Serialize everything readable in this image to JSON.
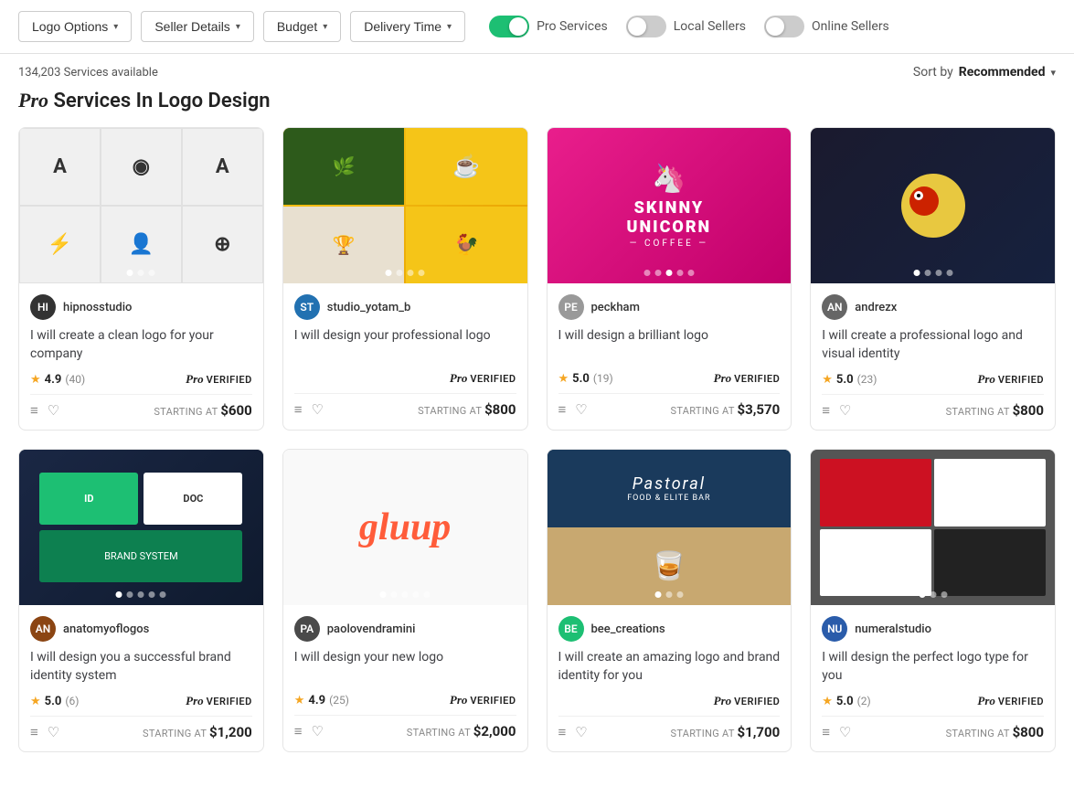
{
  "filterBar": {
    "buttons": [
      {
        "id": "logo-options",
        "label": "Logo Options"
      },
      {
        "id": "seller-details",
        "label": "Seller Details"
      },
      {
        "id": "budget",
        "label": "Budget"
      },
      {
        "id": "delivery-time",
        "label": "Delivery Time"
      }
    ],
    "toggles": [
      {
        "id": "pro-services",
        "label": "Pro Services",
        "state": "on"
      },
      {
        "id": "local-sellers",
        "label": "Local Sellers",
        "state": "off"
      },
      {
        "id": "online-sellers",
        "label": "Online Sellers",
        "state": "off"
      }
    ]
  },
  "resultsBar": {
    "count": "134,203 Services available",
    "sortLabel": "Sort by",
    "sortValue": "Recommended"
  },
  "pageTitle": {
    "prefix": "Pro",
    "suffix": " Services In Logo Design"
  },
  "cards": [
    {
      "id": "card-1",
      "bgClass": "bg-gray",
      "sellerName": "hipnosstudio",
      "sellerColor": "#222",
      "title": "I will create a clean logo for your company",
      "rating": "4.9",
      "ratingCount": "(40)",
      "price": "$600",
      "dots": 3,
      "activeDot": 0,
      "artType": "logo-grid"
    },
    {
      "id": "card-2",
      "bgClass": "bg-yellow",
      "sellerName": "studio_yotam_b",
      "sellerColor": "#2271b1",
      "title": "I will design your professional logo",
      "rating": null,
      "ratingCount": null,
      "price": "$800",
      "dots": 4,
      "activeDot": 0,
      "artType": "yellow-collage"
    },
    {
      "id": "card-3",
      "bgClass": "bg-pink",
      "sellerName": "peckham",
      "sellerColor": "#888",
      "title": "I will design a brilliant logo",
      "rating": "5.0",
      "ratingCount": "(19)",
      "price": "$3,570",
      "dots": 5,
      "activeDot": 2,
      "artType": "skinny-unicorn"
    },
    {
      "id": "card-4",
      "bgClass": "bg-dark",
      "sellerName": "andrezx",
      "sellerColor": "#555",
      "title": "I will create a professional logo and visual identity",
      "rating": "5.0",
      "ratingCount": "(23)",
      "price": "$800",
      "dots": 4,
      "activeDot": 0,
      "artType": "bird-logo"
    },
    {
      "id": "card-5",
      "bgClass": "bg-navy",
      "sellerName": "anatomyoflogos",
      "sellerColor": "#8b4513",
      "title": "I will design you a successful brand identity system",
      "rating": "5.0",
      "ratingCount": "(6)",
      "price": "$1,200",
      "dots": 5,
      "activeDot": 0,
      "artType": "brand-identity"
    },
    {
      "id": "card-6",
      "bgClass": "bg-white-card",
      "sellerName": "paolovendramini",
      "sellerColor": "#666",
      "title": "I will design your new logo",
      "rating": "4.9",
      "ratingCount": "(25)",
      "price": "$2,000",
      "dots": 5,
      "activeDot": 0,
      "artType": "gluup"
    },
    {
      "id": "card-7",
      "bgClass": "bg-blue-card",
      "sellerName": "bee_creations",
      "sellerColor": "#1dbf73",
      "title": "I will create an amazing logo and brand identity for you",
      "rating": null,
      "ratingCount": null,
      "price": "$1,700",
      "dots": 3,
      "activeDot": 0,
      "artType": "pastoral"
    },
    {
      "id": "card-8",
      "bgClass": "bg-gray-card",
      "sellerName": "numeralstudio",
      "sellerColor": "#2a5caa",
      "title": "I will design the perfect logo type for you",
      "rating": "5.0",
      "ratingCount": "(2)",
      "price": "$800",
      "dots": 3,
      "activeDot": 0,
      "artType": "red-white"
    }
  ],
  "labels": {
    "startingAt": "STARTING AT",
    "proVerified": "PRO VERIFIED",
    "proItalic": "Pro"
  }
}
